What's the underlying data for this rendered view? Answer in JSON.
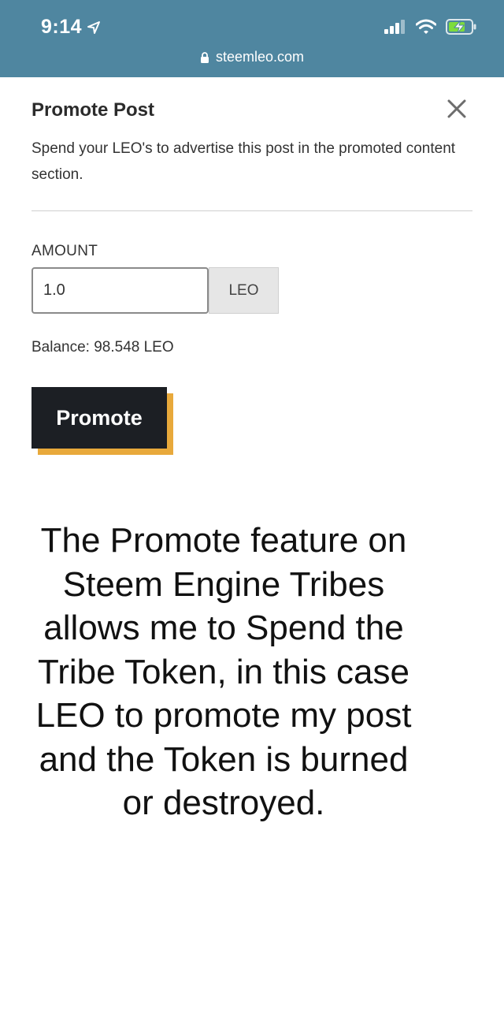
{
  "status_bar": {
    "time": "9:14",
    "url": "steemleo.com",
    "icons": [
      "location-arrow-icon",
      "cellular-signal-icon",
      "wifi-icon",
      "battery-charging-icon",
      "lock-icon"
    ]
  },
  "modal": {
    "title": "Promote Post",
    "description": "Spend your LEO's to advertise this post in the promoted content section.",
    "amount_label": "AMOUNT",
    "amount_value": "1.0",
    "unit": "LEO",
    "balance": "Balance: 98.548 LEO",
    "promote_label": "Promote",
    "close_icon": "close-icon"
  },
  "caption": "The Promote feature on Steem Engine Tribes allows me to Spend the Tribe Token, in this case LEO to promote my post and the Token is burned or destroyed.",
  "colors": {
    "status_bar_bg": "#4f86a0",
    "button_bg": "#1c1f24",
    "button_shadow": "#e8a93b",
    "battery_green": "#7ddc3c"
  }
}
